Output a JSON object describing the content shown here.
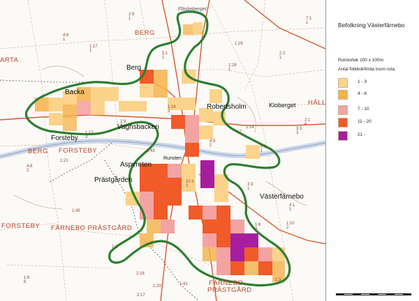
{
  "legend": {
    "title": "Befolkning Västerfärnebo",
    "grid_note": "Rutstorlek 100 x 100m",
    "count_note": "Antal folkbokförda inom ruta.",
    "items": [
      {
        "label": "1 - 3",
        "color": "#fbd38a"
      },
      {
        "label": "4 - 6",
        "color": "#f4b24a"
      },
      {
        "label": "7 - 10",
        "color": "#f4a3a3"
      },
      {
        "label": "11 - 20",
        "color": "#f15a29"
      },
      {
        "label": "21 -",
        "color": "#a61e9d"
      }
    ]
  },
  "places": {
    "flaskeberget": "Fläskeberget",
    "berg_top": "BERG",
    "berg": "Berg",
    "backa": "Backa",
    "robertsholm": "Robertsholm",
    "kloberget": "Kloberget",
    "halle": "HÄLL",
    "vaghsbacken": "Vaghsbacken",
    "forsteby": "Forsteby",
    "berg_west": "BERG",
    "forsteby_caps": "FORSTEBY",
    "runsten": "Runsten",
    "aspvreten": "Aspvreten",
    "prastgarden": "Prästgården",
    "vasterfarnebo": "Västerfärnebo",
    "forsteby_sw": "FORSTEBY",
    "farnebo_prastgard": "FÄRNEBO PRÄSTGÅRD",
    "farnebo": "FÄRNEBO",
    "prastgard": "PRÄSTGÅRD",
    "arta": "ARTA"
  },
  "properties": [
    "2:9\n1",
    "4:8\n1",
    "1:17\n1",
    "1:29",
    "2:2\n1",
    "7:1\n1",
    "1:28\n1",
    "5:1\n1",
    "1:14\n3",
    "1:17\n3",
    "2:9\n3",
    "4:7",
    "2:1\n6",
    "3:3\n3",
    "6:2\n1",
    "1:43",
    "10:1\n1",
    "4:9\n2",
    "1:45",
    "1:21",
    "4:8\n2",
    "3:3\n1",
    "4:1\n1",
    "1:6\n3",
    "1:10\n2",
    "2:2",
    "2:18",
    "1:6\n6",
    "2:20",
    "1:41",
    "2:17",
    "1:14",
    "1:3"
  ]
}
